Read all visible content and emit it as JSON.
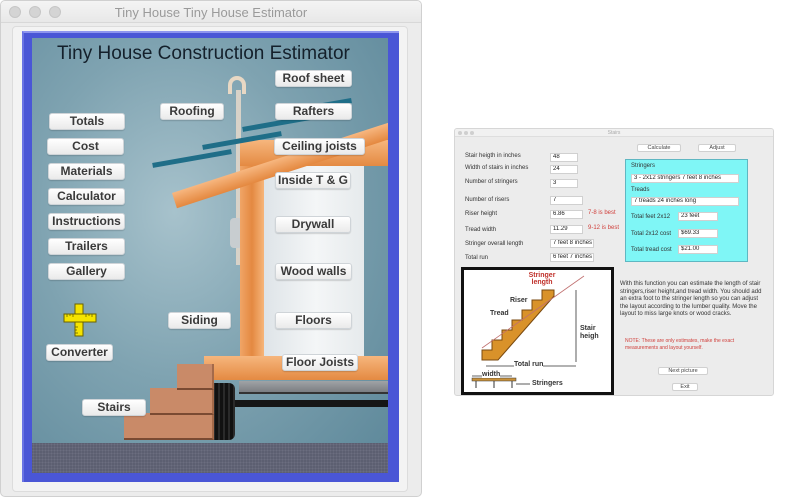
{
  "main_window": {
    "title": "Tiny House Tiny House Estimator",
    "app_title": "Tiny House Construction Estimator",
    "left_menu": [
      {
        "label": "Totals"
      },
      {
        "label": "Cost"
      },
      {
        "label": "Materials"
      },
      {
        "label": "Calculator"
      },
      {
        "label": "Instructions"
      },
      {
        "label": "Trailers"
      },
      {
        "label": "Gallery"
      }
    ],
    "converter_label": "Converter",
    "converter_icon": "ruler-cross-icon",
    "house_parts": {
      "roof_sheet": "Roof sheet",
      "roofing": "Roofing",
      "rafters": "Rafters",
      "ceiling_joists": "Ceiling joists",
      "inside_tg": "Inside T & G",
      "drywall": "Drywall",
      "wood_walls": "Wood walls",
      "siding": "Siding",
      "floors": "Floors",
      "floor_joists": "Floor Joists",
      "stairs": "Stairs"
    }
  },
  "stairs_window": {
    "title": "Stairs",
    "buttons": {
      "calculate": "Calculate",
      "adjust": "Adjust",
      "next_picture": "Next picture",
      "exit": "Exit"
    },
    "inputs": [
      {
        "label": "Stair heigth in inches",
        "value": "48"
      },
      {
        "label": "Width of stairs in inches",
        "value": "24"
      },
      {
        "label": "Number of stringers",
        "value": "3"
      }
    ],
    "outputs": [
      {
        "label": "Number of risers",
        "value": "7",
        "hint": ""
      },
      {
        "label": "Riser height",
        "value": "6.86",
        "hint": "7-8 is best"
      },
      {
        "label": "Tread width",
        "value": "11.29",
        "hint": "9-12 is best"
      },
      {
        "label": "Stringer overall length",
        "value": "7 feet  8 inches",
        "hint": ""
      },
      {
        "label": "Total run",
        "value": "6 feet  7 inches",
        "hint": ""
      }
    ],
    "results_panel": {
      "stringers_heading": "Stringers",
      "stringers_value": "3 - 2x12  stringers   7 feet  8 inches",
      "treads_heading": "Treads",
      "treads_value": "7 treads   24   inches long",
      "total_feet_label": "Total feet 2x12",
      "total_feet_value": "23 feet",
      "total_2x12_cost_label": "Total 2x12 cost",
      "total_2x12_cost_value": "$69.33",
      "total_tread_cost_label": "Total tread cost",
      "total_tread_cost_value": "$21.00",
      "panel_color": "#7ff6f6"
    },
    "diagram_labels": {
      "stringer_length": "Stringer length",
      "riser": "Riser",
      "tread": "Tread",
      "stair_height": "Stair heigh",
      "total_run": "Total run",
      "width": "width",
      "stringers": "Stringers"
    },
    "description": "With this function you can estimate the length of stair stringers,riser height,and tread width. You should add an extra foot to the stringer length so you can adjust the layout according to the lumber quality. Move the layout to miss large knots or wood cracks.",
    "note": "NOTE: These are only estimates, make the exact measurements and layout yourself.",
    "hint_color": "#d0403c"
  }
}
